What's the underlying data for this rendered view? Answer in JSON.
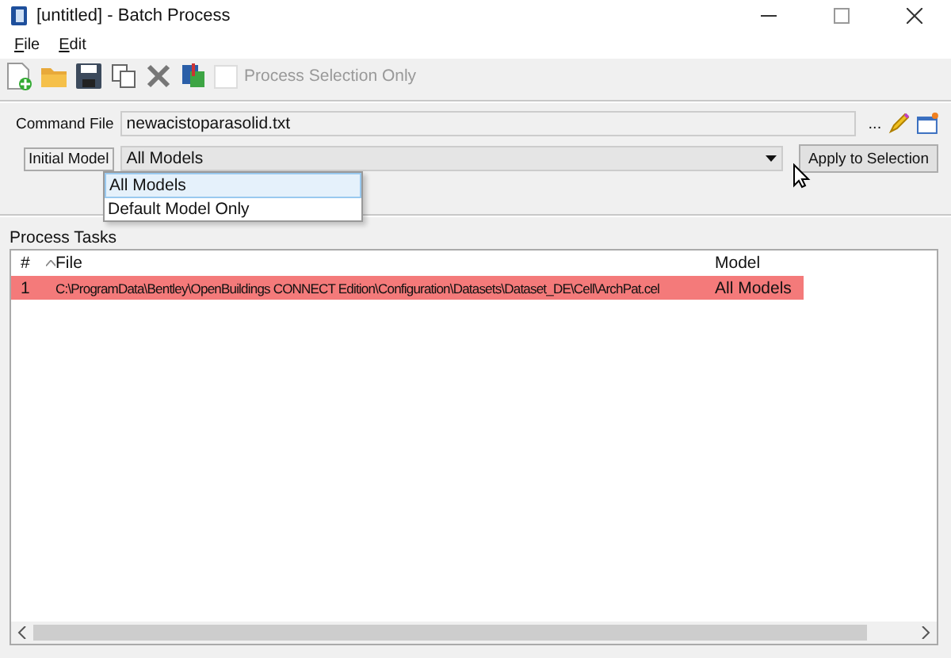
{
  "window": {
    "title": "[untitled] - Batch Process"
  },
  "menu": [
    {
      "label": "File"
    },
    {
      "label": "Edit"
    }
  ],
  "toolbar": {
    "process_selection_only": {
      "label": "Process Selection Only",
      "checked": false,
      "disabled": true
    }
  },
  "command_file": {
    "label": "Command File",
    "value": "newacistoparasolid.txt",
    "browse": "..."
  },
  "initial_model": {
    "label": "Initial Model",
    "value": "All Models",
    "options": [
      {
        "label": "All Models",
        "selected": true
      },
      {
        "label": "Default Model Only",
        "selected": false
      }
    ],
    "apply_button": "Apply to Selection"
  },
  "process_tasks": {
    "title": "Process Tasks",
    "columns": [
      "#",
      "File",
      "Model"
    ],
    "rows": [
      {
        "cells": [
          "1",
          "C:\\ProgramData\\Bentley\\OpenBuildings CONNECT Edition\\Configuration\\Datasets\\Dataset_DE\\Cell\\ArchPat.cel",
          "All Models"
        ],
        "selected": true
      }
    ]
  }
}
